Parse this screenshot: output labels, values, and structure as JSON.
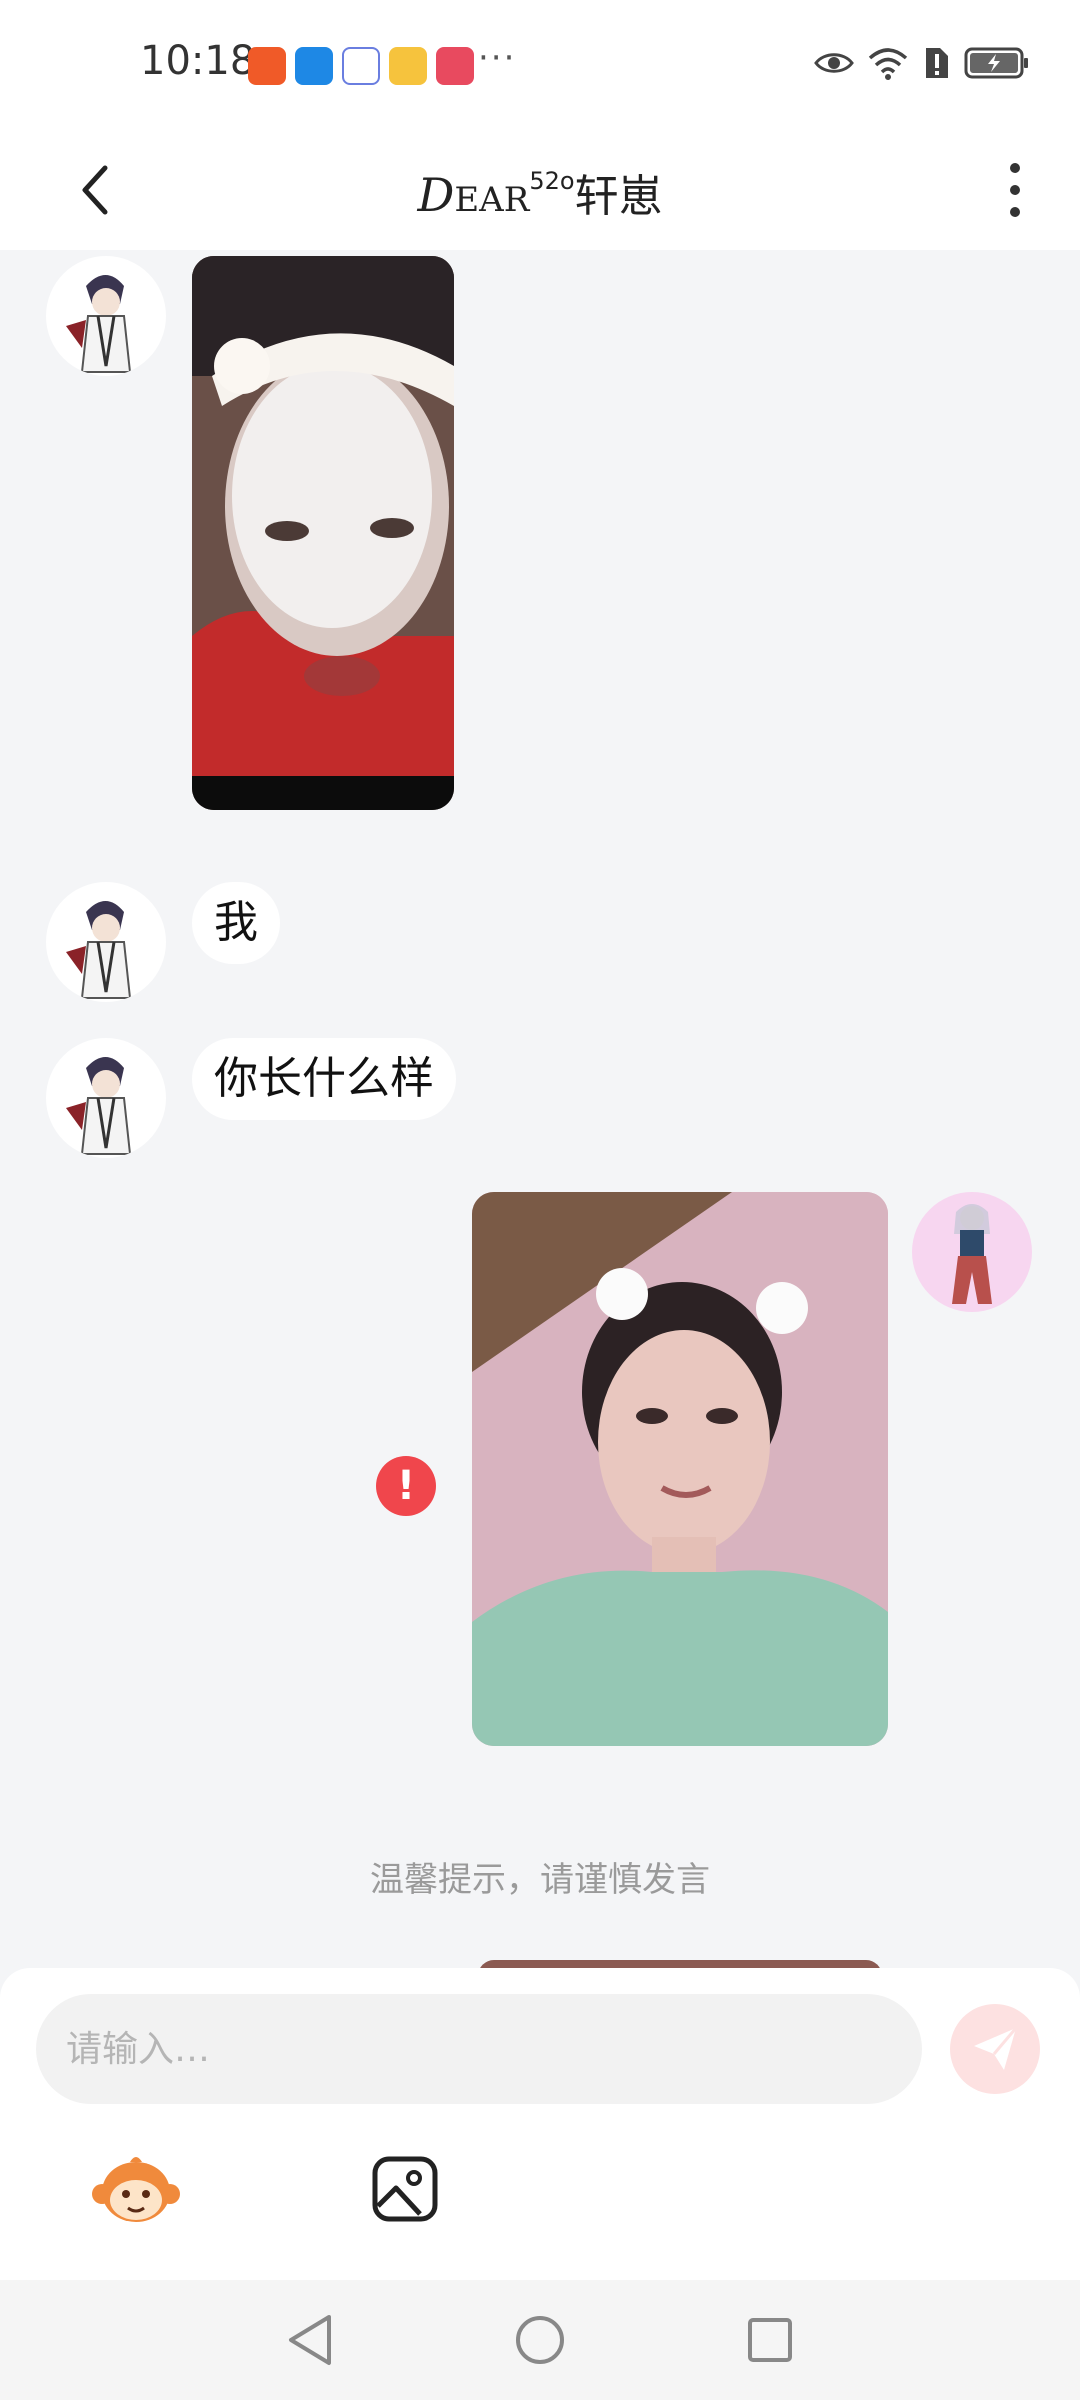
{
  "status_bar": {
    "time": "10:18",
    "more": "···",
    "battery_icon": "battery-charging-icon",
    "wifi_icon": "wifi-icon",
    "eye_icon": "eye-icon"
  },
  "header": {
    "title_dear_d": "D",
    "title_dear_rest": "EAR",
    "title_sup": "52o",
    "title_name": "轩崽"
  },
  "messages": [
    {
      "side": "left",
      "type": "image",
      "subject": "face-mask-selfie"
    },
    {
      "side": "left",
      "type": "text",
      "text": "我"
    },
    {
      "side": "left",
      "type": "text",
      "text": "你长什么样"
    },
    {
      "side": "right",
      "type": "image",
      "subject": "girl-selfie",
      "status": "send-failed",
      "status_text": "!"
    }
  ],
  "tip": "温馨提示，请谨慎发言",
  "input": {
    "placeholder": "请输入…"
  },
  "colors": {
    "background": "#f4f5f7",
    "send_button": "#fde1e1",
    "error": "#f0464c",
    "placeholder": "#b5b5b5"
  }
}
